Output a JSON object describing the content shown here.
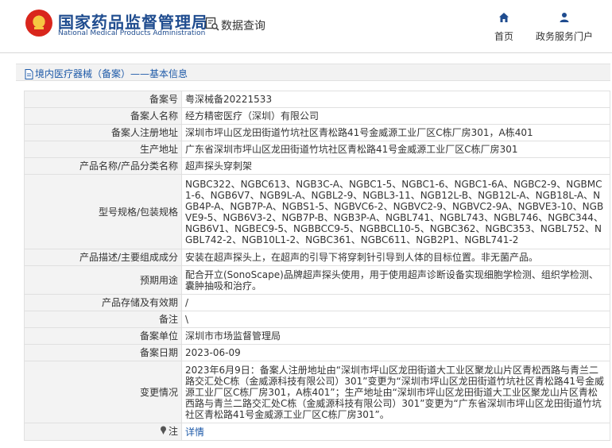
{
  "header": {
    "title_cn": "国家药品监督管理局",
    "title_en": "National Medical Products Administration",
    "query_label": "数据查询",
    "nav": [
      {
        "label": "首页",
        "icon": "home-icon"
      },
      {
        "label": "政务服务门户",
        "icon": "user-icon"
      }
    ]
  },
  "breadcrumb": "境内医疗器械（备案）——基本信息",
  "fields": [
    {
      "label": "备案号",
      "value": "粤深械备20221533"
    },
    {
      "label": "备案人名称",
      "value": "经方精密医疗（深圳）有限公司"
    },
    {
      "label": "备案人注册地址",
      "value": "深圳市坪山区龙田街道竹坑社区青松路41号金威源工业厂区C栋厂房301，A栋401"
    },
    {
      "label": "生产地址",
      "value": "广东省深圳市坪山区龙田街道竹坑社区青松路41号金威源工业厂区C栋厂房301"
    },
    {
      "label": "产品名称/产品分类名称",
      "value": "超声探头穿刺架"
    },
    {
      "label": "型号规格/包装规格",
      "value": "NGBC322、NGBC613、NGB3C-A、NGBC1-5、NGBC1-6、NGBC1-6A、NGBC2-9、NGBMC1-6、NGB6V7、NGB9L-A、NGBL2-9、NGBL3-11、NGB12L-B、NGB12L-A、NGB18L-A、NGB4P-A、NGB7P-A、NGBS1-5、NGBVC6-2、NGBVC2-9、NGBVC2-9A、NGBVE3-10、NGBVE9-5、NGB6V3-2、NGB7P-B、NGB3P-A、NGBL741、NGBL743、NGBL746、NGBC344、NGB6V1、NGBEC9-5、NGBBCC9-5、NGBBCL10-5、NGBC362、NGBC353、NGBL752、NGBL742-2、NGB10L1-2、NGBC361、NGBC611、NGB2P1、NGBL741-2"
    },
    {
      "label": "产品描述/主要组成成分",
      "value": "安装在超声探头上，在超声的引导下将穿刺针引导到人体的目标位置。非无菌产品。"
    },
    {
      "label": "预期用途",
      "value": "配合开立(SonoScape)品牌超声探头使用，用于使用超声诊断设备实现细胞学检测、组织学检测、囊肿抽吸和治疗。"
    },
    {
      "label": "产品存储及有效期",
      "value": "/"
    },
    {
      "label": "备注",
      "value": "\\"
    },
    {
      "label": "备案单位",
      "value": "深圳市市场监督管理局"
    },
    {
      "label": "备案日期",
      "value": "2023-06-09"
    },
    {
      "label": "变更情况",
      "value": "2023年6月9日：备案人注册地址由“深圳市坪山区龙田街道大工业区聚龙山片区青松西路与青兰二路交汇处C栋（金威源科技有限公司）301”变更为“深圳市坪山区龙田街道竹坑社区青松路41号金威源工业厂区C栋厂房301，A栋401”；生产地址由“深圳市坪山区龙田街道大工业区聚龙山片区青松西路与青兰二路交汇处C栋（金威源科技有限公司）301”变更为“广东省深圳市坪山区龙田街道竹坑社区青松路41号金威源工业厂区C栋厂房301”。"
    }
  ],
  "note_row": {
    "label": "注",
    "link": "详情"
  },
  "colors": {
    "brand_blue": "#1f4c8f",
    "link_blue": "#1e5aa8",
    "label_bg": "#f3f3f3",
    "emblem_red": "#d9261c"
  }
}
